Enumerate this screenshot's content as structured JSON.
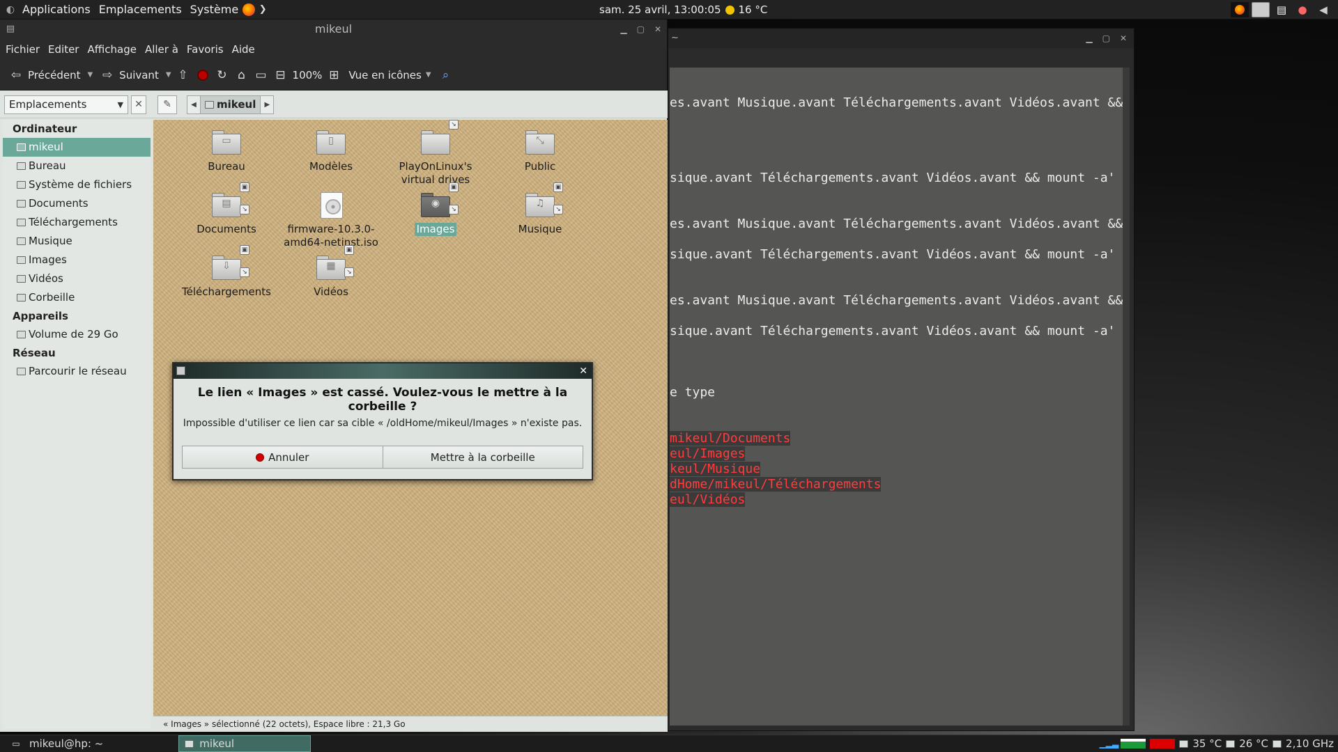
{
  "top_panel": {
    "menus": [
      "Applications",
      "Emplacements",
      "Système"
    ],
    "clock": "sam. 25 avril, 13:00:05",
    "weather": "16 °C"
  },
  "file_manager": {
    "title": "mikeul",
    "menubar": [
      "Fichier",
      "Editer",
      "Affichage",
      "Aller à",
      "Favoris",
      "Aide"
    ],
    "toolbar": {
      "back": "Précédent",
      "forward": "Suivant",
      "zoom": "100%",
      "view_mode": "Vue en icônes"
    },
    "places_select": "Emplacements",
    "breadcrumb": "mikeul",
    "sidebar": {
      "computer_header": "Ordinateur",
      "computer_items": [
        "mikeul",
        "Bureau",
        "Système de fichiers",
        "Documents",
        "Téléchargements",
        "Musique",
        "Images",
        "Vidéos",
        "Corbeille"
      ],
      "devices_header": "Appareils",
      "device_items": [
        "Volume de 29 Go"
      ],
      "network_header": "Réseau",
      "network_items": [
        "Parcourir le réseau"
      ]
    },
    "items": [
      {
        "label": "Bureau",
        "icon": "desktop-folder-icon"
      },
      {
        "label": "Modèles",
        "icon": "templates-folder-icon"
      },
      {
        "label": "PlayOnLinux's virtual drives",
        "icon": "folder-link-icon"
      },
      {
        "label": "Public",
        "icon": "public-folder-icon"
      },
      {
        "label": "Documents",
        "icon": "documents-folder-icon"
      },
      {
        "label": "firmware-10.3.0-amd64-netinst.iso",
        "icon": "disc-image-icon"
      },
      {
        "label": "Images",
        "icon": "pictures-folder-icon"
      },
      {
        "label": "Musique",
        "icon": "music-folder-icon"
      },
      {
        "label": "Téléchargements",
        "icon": "downloads-folder-icon"
      },
      {
        "label": "Vidéos",
        "icon": "videos-folder-icon"
      }
    ],
    "status": "« Images » sélectionné (22 octets), Espace libre : 21,3 Go"
  },
  "dialog": {
    "title": "Le lien « Images » est cassé. Voulez-vous le mettre à la corbeille ?",
    "message": "Impossible d'utiliser ce lien car sa cible « /oldHome/mikeul/Images » n'existe pas.",
    "cancel_label": "Annuler",
    "trash_label": "Mettre à la corbeille"
  },
  "terminal": {
    "title": "~",
    "lines": [
      "es.avant Musique.avant Téléchargements.avant Vidéos.avant && moun",
      "sique.avant Téléchargements.avant Vidéos.avant && mount -a'",
      "es.avant Musique.avant Téléchargements.avant Vidéos.avant && moun",
      "sique.avant Téléchargements.avant Vidéos.avant && mount -a'",
      "es.avant Musique.avant Téléchargements.avant Vidéos.avant && moun",
      "sique.avant Téléchargements.avant Vidéos.avant && mount -a'",
      "e type"
    ],
    "error_lines": [
      "mikeul/Documents",
      "eul/Images",
      "keul/Musique",
      "dHome/mikeul/Téléchargements",
      "eul/Vidéos"
    ]
  },
  "bottom_panel": {
    "task_terminal": "mikeul@hp: ~",
    "task_filemanager": "mikeul",
    "temp_cpu": "35 °C",
    "temp_other": "26 °C",
    "cpu_freq": "2,10 GHz"
  },
  "colors": {
    "selection": "#6aa99a",
    "terminal_error": "#ff3d3d"
  }
}
